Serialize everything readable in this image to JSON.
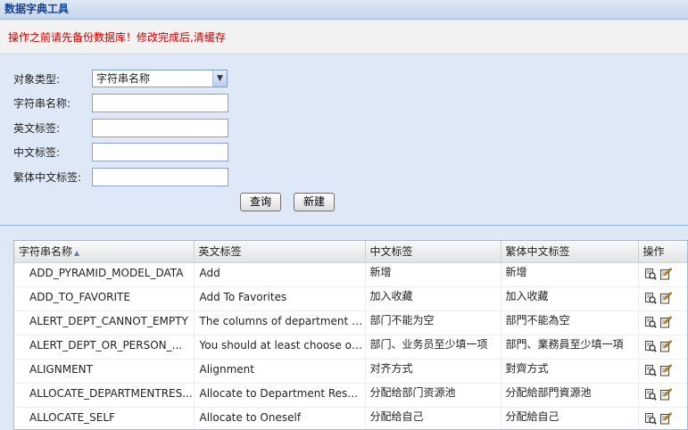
{
  "window": {
    "title": "数据字典工具"
  },
  "warning": "操作之前请先备份数据库！修改完成后,清缓存",
  "form": {
    "object_type": {
      "label": "对象类型:",
      "value": "字符串名称"
    },
    "string_name": {
      "label": "字符串名称:",
      "value": ""
    },
    "english_label": {
      "label": "英文标签:",
      "value": ""
    },
    "chinese_label": {
      "label": "中文标签:",
      "value": ""
    },
    "traditional_label": {
      "label": "繁体中文标签:",
      "value": ""
    },
    "query_button": "查询",
    "new_button": "新建"
  },
  "grid": {
    "columns": [
      "字符串名称",
      "英文标签",
      "中文标签",
      "繁体中文标签",
      "操作"
    ],
    "sorted_column": 0,
    "sort_direction": "asc",
    "rows": [
      [
        "ADD_PYRAMID_MODEL_DATA",
        "Add",
        "新增",
        "新增"
      ],
      [
        "ADD_TO_FAVORITE",
        "Add To Favorites",
        "加入收藏",
        "加入收藏"
      ],
      [
        "ALERT_DEPT_CANNOT_EMPTY",
        "The columns of department can...",
        "部门不能为空",
        "部門不能為空"
      ],
      [
        "ALERT_DEPT_OR_PERSON_...",
        "You should at least choose one ...",
        "部门、业务员至少填一项",
        "部門、業務員至少填一項"
      ],
      [
        "ALIGNMENT",
        "Alignment",
        "对齐方式",
        "對齊方式"
      ],
      [
        "ALLOCATE_DEPARTMENTRES...",
        "Allocate to Department Resourc...",
        "分配给部门资源池",
        "分配給部門資源池"
      ],
      [
        "ALLOCATE_SELF",
        "Allocate to Oneself",
        "分配给自己",
        "分配給自己"
      ]
    ],
    "row_actions": [
      "preview-icon",
      "edit-icon"
    ]
  },
  "colors": {
    "accent": "#15428b",
    "warning": "#cc0000",
    "panel": "#dfe8f6"
  }
}
